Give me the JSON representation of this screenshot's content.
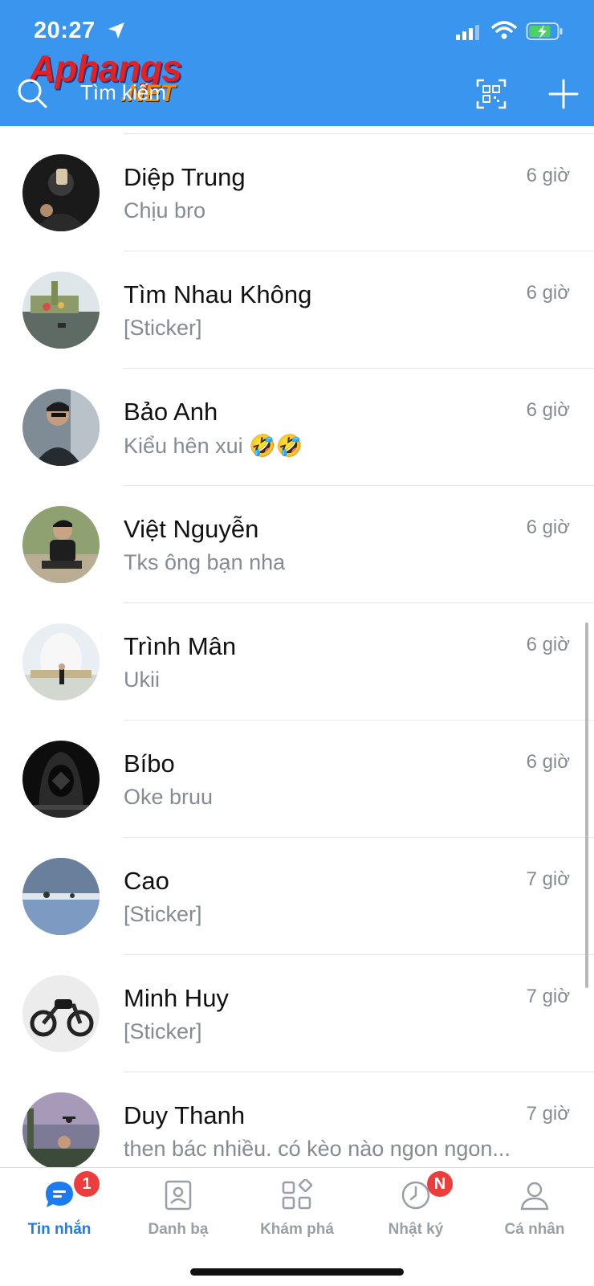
{
  "status_bar": {
    "time": "20:27"
  },
  "header": {
    "logo_text": "Aphangs",
    "logo_suffix": ".NET",
    "search_placeholder": "Tìm kiếm",
    "colors": {
      "background": "#3a95ef",
      "logo_red": "#e22222",
      "logo_orange": "#f08a12"
    }
  },
  "conversations": [
    {
      "name": "Diệp Trung",
      "message": "Chịu bro",
      "time": "6 giờ",
      "avatar_color": "#1a1a1a"
    },
    {
      "name": "Tìm Nhau Không",
      "message": "[Sticker]",
      "time": "6 giờ",
      "avatar_color": "#6f7f5a"
    },
    {
      "name": "Bảo Anh",
      "message": "Kiểu hên xui 🤣🤣",
      "time": "6 giờ",
      "avatar_color": "#4a5868"
    },
    {
      "name": "Việt Nguyễn",
      "message": "Tks ông bạn nha",
      "time": "6 giờ",
      "avatar_color": "#7d8d66"
    },
    {
      "name": "Trình Mân",
      "message": "Ukii",
      "time": "6 giờ",
      "avatar_color": "#cfd8de"
    },
    {
      "name": "Bíbo",
      "message": "Oke bruu",
      "time": "6 giờ",
      "avatar_color": "#141414"
    },
    {
      "name": "Cao",
      "message": "[Sticker]",
      "time": "7 giờ",
      "avatar_color": "#5f7ea8"
    },
    {
      "name": "Minh Huy",
      "message": "[Sticker]",
      "time": "7 giờ",
      "avatar_color": "#d8d8d8"
    },
    {
      "name": "Duy Thanh",
      "message": "then bác nhiều. có kèo nào ngon ngon...",
      "time": "7 giờ",
      "avatar_color": "#6f6f8a"
    }
  ],
  "tabs": [
    {
      "label": "Tin nhắn",
      "icon": "chat-bubble-icon",
      "badge": "1",
      "active": true
    },
    {
      "label": "Danh bạ",
      "icon": "contacts-icon",
      "badge": "",
      "active": false
    },
    {
      "label": "Khám phá",
      "icon": "discover-grid-icon",
      "badge": "",
      "active": false
    },
    {
      "label": "Nhật ký",
      "icon": "clock-icon",
      "badge": "N",
      "active": false
    },
    {
      "label": "Cá nhân",
      "icon": "person-icon",
      "badge": "",
      "active": false
    }
  ],
  "tab_colors": {
    "active": "#1b7cf2",
    "inactive": "#9a9ea6",
    "badge": "#ec3c3c"
  }
}
